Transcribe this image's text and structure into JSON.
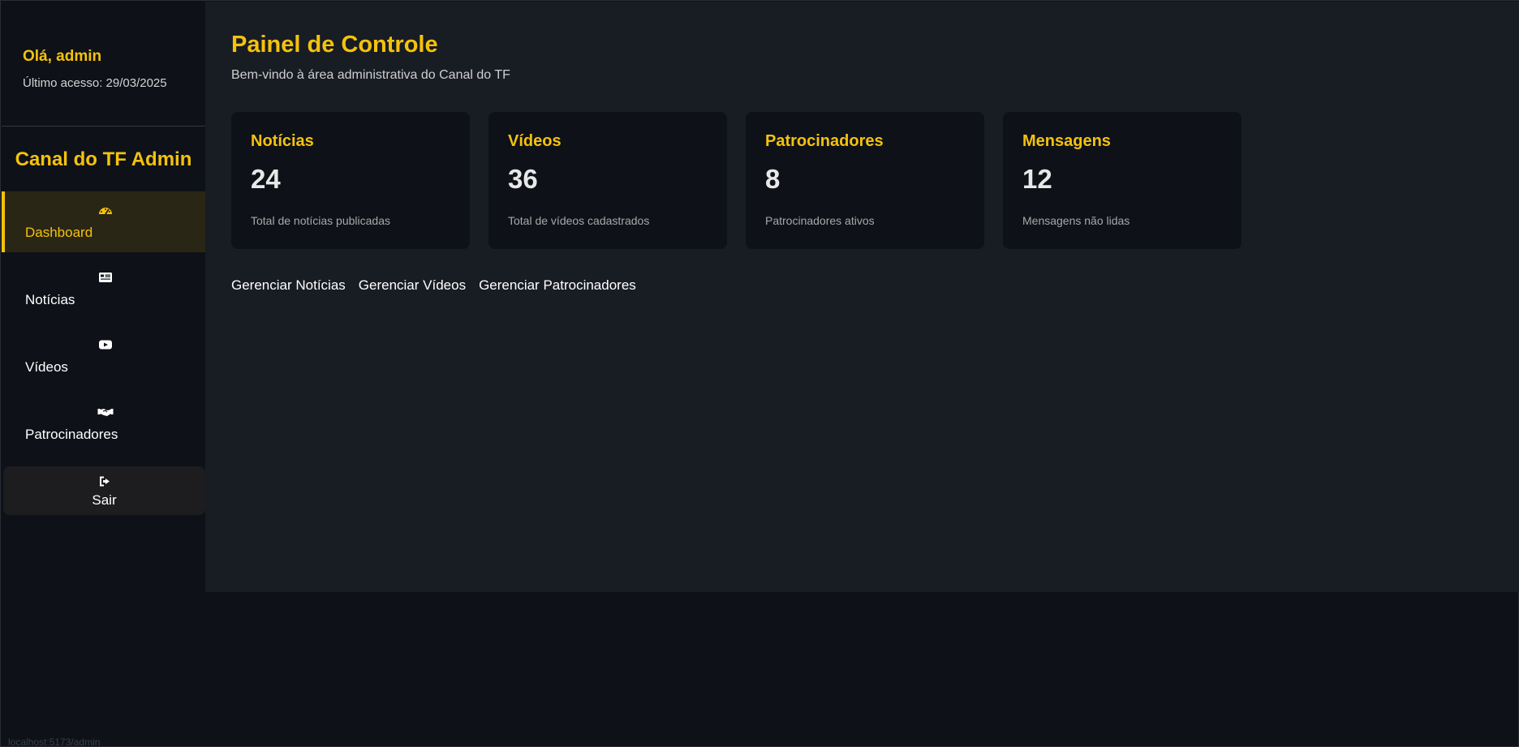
{
  "sidebar": {
    "greeting": "Olá, admin",
    "last_access": "Último acesso: 29/03/2025",
    "brand": "Canal do TF Admin",
    "items": [
      {
        "label": "Dashboard",
        "icon": "gauge-icon",
        "active": true
      },
      {
        "label": "Notícias",
        "icon": "newspaper-icon",
        "active": false
      },
      {
        "label": "Vídeos",
        "icon": "youtube-icon",
        "active": false
      },
      {
        "label": "Patrocinadores",
        "icon": "handshake-icon",
        "active": false
      }
    ],
    "logout": {
      "label": "Sair",
      "icon": "sign-out-icon"
    }
  },
  "status_url": "localhost:5173/admin",
  "main": {
    "title": "Painel de Controle",
    "subtitle": "Bem-vindo à área administrativa do Canal do TF",
    "cards": [
      {
        "title": "Notícias",
        "value": "24",
        "description": "Total de notícias publicadas"
      },
      {
        "title": "Vídeos",
        "value": "36",
        "description": "Total de vídeos cadastrados"
      },
      {
        "title": "Patrocinadores",
        "value": "8",
        "description": "Patrocinadores ativos"
      },
      {
        "title": "Mensagens",
        "value": "12",
        "description": "Mensagens não lidas"
      }
    ],
    "links": [
      {
        "label": "Gerenciar Notícias"
      },
      {
        "label": "Gerenciar Vídeos"
      },
      {
        "label": "Gerenciar Patrocinadores"
      }
    ]
  },
  "colors": {
    "accent": "#f4c20d",
    "sidebar_bg": "#0e1118",
    "main_bg": "#181c23",
    "card_bg": "#0e1118",
    "active_bg": "#2a2616"
  }
}
